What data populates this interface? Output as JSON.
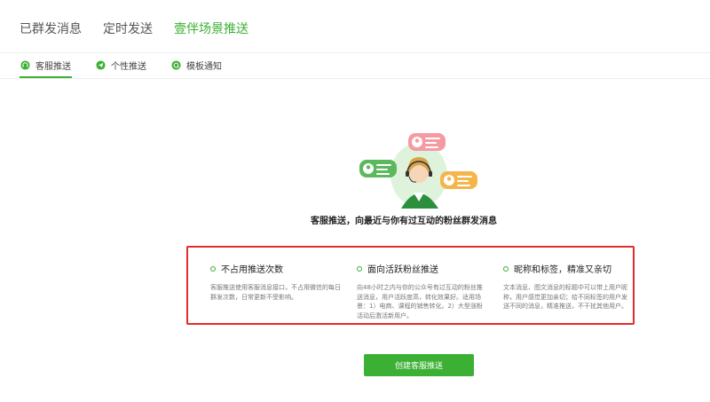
{
  "main_tabs": [
    {
      "label": "已群发消息"
    },
    {
      "label": "定时发送"
    },
    {
      "label": "壹伴场景推送"
    }
  ],
  "sub_tabs": [
    {
      "label": "客服推送",
      "icon": "headset-icon"
    },
    {
      "label": "个性推送",
      "icon": "send-icon"
    },
    {
      "label": "模板通知",
      "icon": "template-icon"
    }
  ],
  "headline": "客服推送，向最近与你有过互动的粉丝群发消息",
  "features": [
    {
      "title": "不占用推送次数",
      "desc": "客服推送使用客服消息接口，不占用微信的每日群发次数，日常更新不受影响。"
    },
    {
      "title": "面向活跃粉丝推送",
      "desc": "向48小时之内与你的公众号有过互动的粉丝推送消息，用户活跃度高，转化效果好。适用场景：1）电商、课程的销售转化。2）大型涨粉活动后激活新用户。"
    },
    {
      "title": "昵称和标签，精准又亲切",
      "desc": "文本消息、图文消息的标题中可以带上用户昵称，用户感觉更加亲切；给不同标签的用户发送不同的消息，精准推送，不干扰其他用户。"
    }
  ],
  "create_button": "创建客服推送",
  "colors": {
    "accent": "#3cb034",
    "highlight_border": "#e02c2c"
  }
}
